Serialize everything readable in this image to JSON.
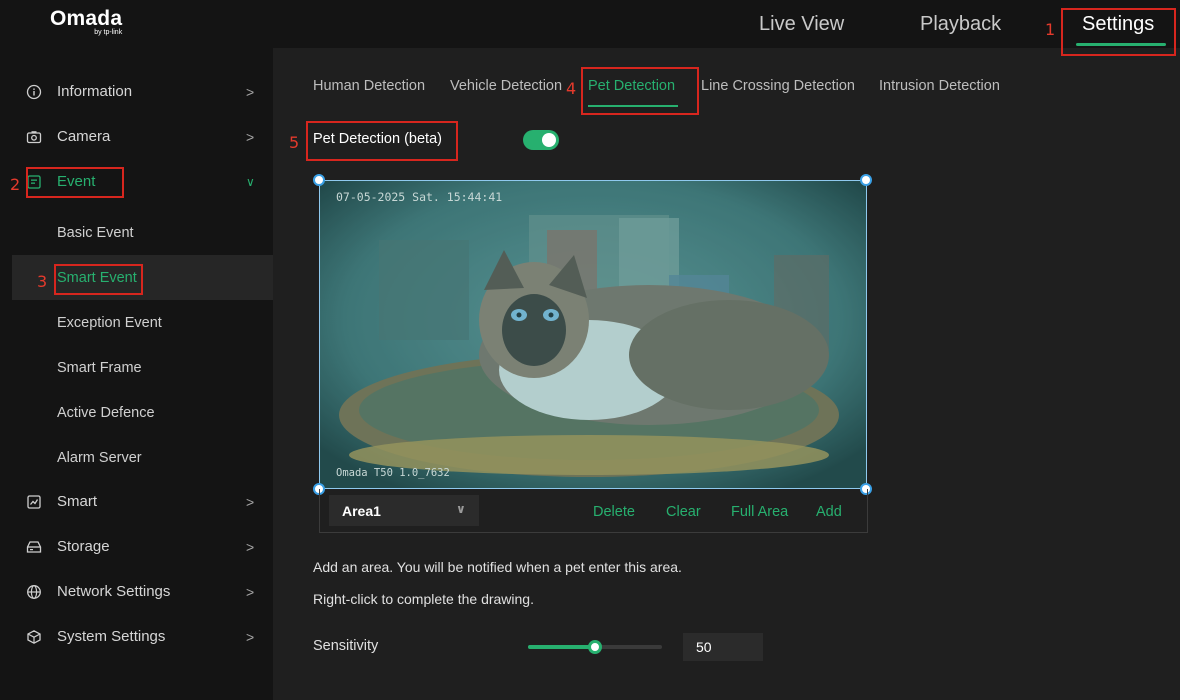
{
  "brand": {
    "name": "Omada",
    "sub": "by tp-link"
  },
  "topnav": {
    "live_view": "Live View",
    "playback": "Playback",
    "settings": "Settings"
  },
  "annotations": [
    "1",
    "2",
    "3",
    "4",
    "5"
  ],
  "sidebar": {
    "items": [
      {
        "label": "Information",
        "icon": "info-icon"
      },
      {
        "label": "Camera",
        "icon": "camera-icon"
      },
      {
        "label": "Event",
        "icon": "event-icon"
      },
      {
        "label": "Smart",
        "icon": "chart-icon"
      },
      {
        "label": "Storage",
        "icon": "storage-icon"
      },
      {
        "label": "Network Settings",
        "icon": "globe-icon"
      },
      {
        "label": "System Settings",
        "icon": "cube-icon"
      }
    ],
    "event_sub": [
      "Basic Event",
      "Smart Event",
      "Exception Event",
      "Smart Frame",
      "Active Defence",
      "Alarm Server"
    ]
  },
  "tabs": [
    "Human Detection",
    "Vehicle Detection",
    "Pet Detection",
    "Line Crossing Detection",
    "Intrusion Detection"
  ],
  "pet_detection": {
    "label": "Pet Detection (beta)",
    "enabled": true
  },
  "video": {
    "timestamp": "07-05-2025 Sat. 15:44:41",
    "watermark": "Omada T50 1.0_7632"
  },
  "area": {
    "selected": "Area1",
    "delete": "Delete",
    "clear": "Clear",
    "full_area": "Full Area",
    "add": "Add"
  },
  "hints": {
    "line1": "Add an area. You will be notified when a pet enter this area.",
    "line2": "Right-click to complete the drawing."
  },
  "sensitivity": {
    "label": "Sensitivity",
    "value": "50",
    "level": 50
  },
  "colors": {
    "accent": "#27b06f",
    "annotation": "#d7261e",
    "handle": "#3aa0e6"
  }
}
